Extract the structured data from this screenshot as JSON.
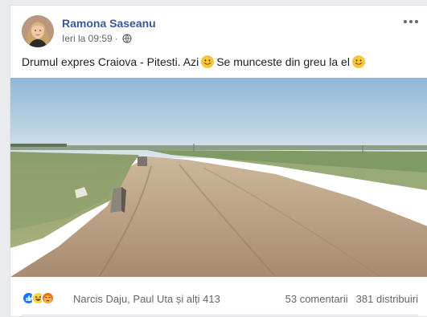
{
  "post": {
    "author": "Ramona Saseanu",
    "timestamp": "Ieri la 09:59",
    "separator": "·",
    "privacy_icon": "globe-icon",
    "text_part1": "Drumul expres Craiova - Pitesti. Azi",
    "text_part2": "Se munceste din greu la el",
    "emoji": "slightly-smiling-face"
  },
  "footer": {
    "reaction_icons": [
      "like-icon",
      "haha-icon",
      "angry-icon"
    ],
    "reactors": "Narcis Daju, Paul Uta și alți 413",
    "comments": "53 comentarii",
    "shares": "381 distribuiri"
  },
  "colors": {
    "author": "#385898",
    "meta": "#616770",
    "like": "#1877f2",
    "reaction_yellow": "#fcd048",
    "angry": "#e9710f"
  }
}
